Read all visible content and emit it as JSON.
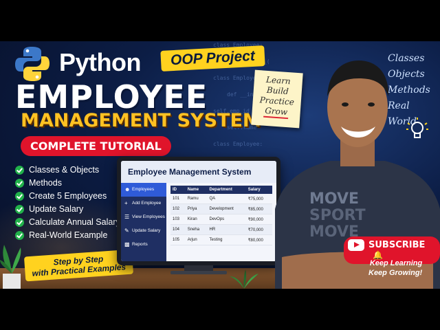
{
  "brand": {
    "word": "Python",
    "tag": "OOP Project"
  },
  "title": {
    "line1": "EMPLOYEE",
    "line2": "MANAGEMENT SYSTEM",
    "pill": "COMPLETE TUTORIAL"
  },
  "note": [
    "Learn",
    "Build",
    "Practice",
    "Grow"
  ],
  "topics": [
    "Classes",
    "Objects",
    "Methods",
    "Real World"
  ],
  "checklist": [
    "Classes & Objects",
    "Methods",
    "Create 5 Employees",
    "Update Salary",
    "Calculate Annual Salary",
    "Real-World Example"
  ],
  "step_tag": {
    "line1": "Step by Step",
    "line2": "with Practical Examples"
  },
  "code_lines": [
    "class Employee:",
    "def __init__(",
    "class Employee:",
    "def __init__(",
    "self.emp_id",
    "self.name",
    "class Employee:",
    "def __init__("
  ],
  "app": {
    "title": "Employee Management System",
    "sidebar": [
      {
        "label": "Employees",
        "icon": "users-icon"
      },
      {
        "label": "Add Employee",
        "icon": "plus-icon"
      },
      {
        "label": "View Employees",
        "icon": "list-icon"
      },
      {
        "label": "Update Salary",
        "icon": "edit-icon"
      },
      {
        "label": "Reports",
        "icon": "chart-icon"
      }
    ],
    "columns": [
      "ID",
      "Name",
      "Department",
      "Salary"
    ],
    "rows": [
      [
        "101",
        "Ramu",
        "QA",
        "₹75,000"
      ],
      [
        "102",
        "Priya",
        "Development",
        "₹85,000"
      ],
      [
        "103",
        "Kiran",
        "DevOps",
        "₹90,000"
      ],
      [
        "104",
        "Sneha",
        "HR",
        "₹70,000"
      ],
      [
        "105",
        "Arjun",
        "Testing",
        "₹80,000"
      ]
    ]
  },
  "shirt": {
    "line1": "MOVE",
    "line2": "SPORT",
    "line3": "MOVE"
  },
  "subscribe": "SUBSCRIBE",
  "keep": {
    "line1": "Keep Learning",
    "line2": "Keep Growing!"
  },
  "colors": {
    "accent_yellow": "#ffd21f",
    "accent_red": "#e0142b",
    "navy": "#0c1d45",
    "check_green": "#21b24a"
  }
}
